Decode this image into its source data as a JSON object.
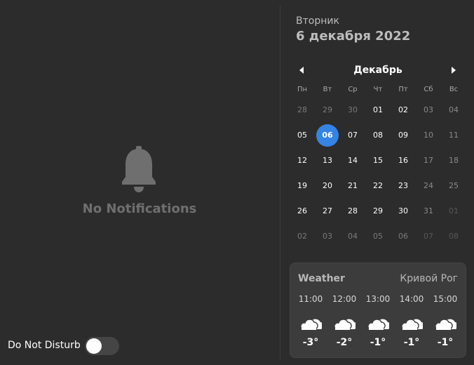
{
  "notifications": {
    "empty_text": "No Notifications",
    "dnd_label": "Do Not Disturb",
    "dnd_enabled": false
  },
  "date": {
    "weekday": "Вторник",
    "full": "6 декабря 2022"
  },
  "calendar": {
    "month": "Декабрь",
    "weekdays": [
      "Пн",
      "Вт",
      "Ср",
      "Чт",
      "Пт",
      "Сб",
      "Вс"
    ],
    "weeks": [
      [
        "28",
        "29",
        "30",
        "01",
        "02",
        "03",
        "04"
      ],
      [
        "05",
        "06",
        "07",
        "08",
        "09",
        "10",
        "11"
      ],
      [
        "12",
        "13",
        "14",
        "15",
        "16",
        "17",
        "18"
      ],
      [
        "19",
        "20",
        "21",
        "22",
        "23",
        "24",
        "25"
      ],
      [
        "26",
        "27",
        "28",
        "29",
        "30",
        "31",
        "01"
      ],
      [
        "02",
        "03",
        "04",
        "05",
        "06",
        "07",
        "08"
      ]
    ],
    "today": "06",
    "accent": "#3584e4"
  },
  "weather": {
    "title": "Weather",
    "location": "Кривой Рог",
    "icon": "partly-cloudy-icon",
    "forecast": [
      {
        "time": "11:00",
        "temp": "-3°"
      },
      {
        "time": "12:00",
        "temp": "-2°"
      },
      {
        "time": "13:00",
        "temp": "-1°"
      },
      {
        "time": "14:00",
        "temp": "-1°"
      },
      {
        "time": "15:00",
        "temp": "-1°"
      }
    ]
  }
}
